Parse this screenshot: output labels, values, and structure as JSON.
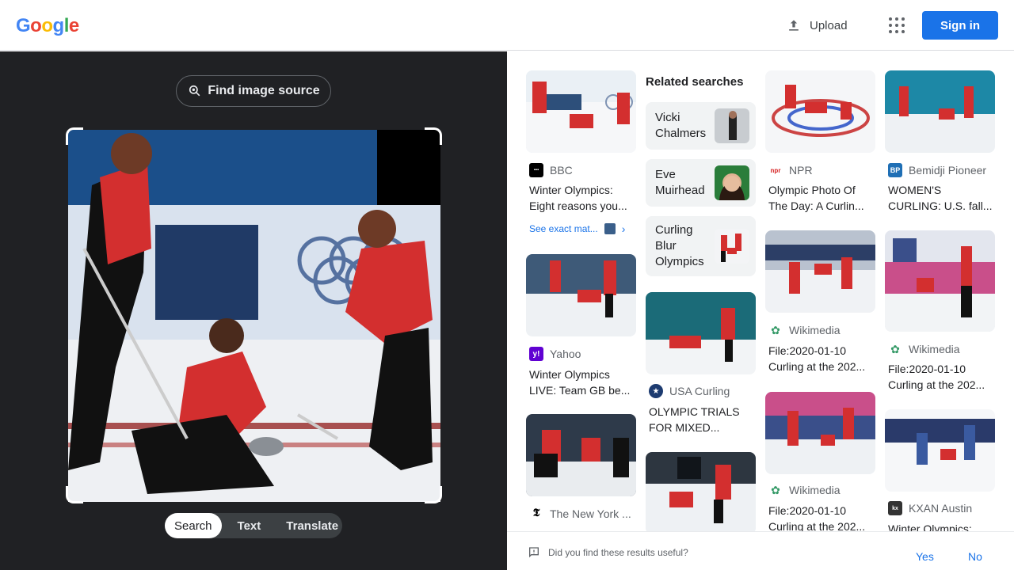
{
  "header": {
    "logo_letters": [
      "G",
      "o",
      "o",
      "g",
      "l",
      "e"
    ],
    "logo_colors": [
      "#4285f4",
      "#ea4335",
      "#fbbc05",
      "#4285f4",
      "#34a853",
      "#ea4335"
    ],
    "upload_label": "Upload",
    "apps_icon": "apps-grid-icon",
    "signin_label": "Sign in"
  },
  "left_panel": {
    "find_source_label": "Find image source",
    "modes": [
      "Search",
      "Text",
      "Translate"
    ],
    "active_mode": "Search"
  },
  "results": {
    "col1": [
      {
        "source": "BBC",
        "title1": "Winter Olympics:",
        "title2": "Eight reasons you...",
        "exact_label": "See exact mat..."
      },
      {
        "source": "Yahoo",
        "title1": "Winter Olympics",
        "title2": "LIVE: Team GB be..."
      },
      {
        "source": "The New York ..."
      }
    ],
    "related": {
      "heading": "Related searches",
      "items": [
        {
          "line1": "Vicki",
          "line2": "Chalmers"
        },
        {
          "line1": "Eve",
          "line2": "Muirhead"
        },
        {
          "line1": "Curling",
          "line2": "Blur",
          "line3": "Olympics"
        }
      ]
    },
    "col2": [
      {
        "source": "USA Curling",
        "title1": "OLYMPIC TRIALS",
        "title2": "FOR MIXED..."
      }
    ],
    "col3": [
      {
        "source": "NPR",
        "title1": "Olympic Photo Of",
        "title2": "The Day: A Curlin..."
      },
      {
        "source": "Wikimedia",
        "title1": "File:2020-01-10",
        "title2": "Curling at the 202..."
      },
      {
        "source": "Wikimedia",
        "title1": "File:2020-01-10",
        "title2": "Curling at the 202..."
      }
    ],
    "col4": [
      {
        "source": "Bemidji Pioneer",
        "title1": "WOMEN'S",
        "title2": "CURLING: U.S. fall..."
      },
      {
        "source": "Wikimedia",
        "title1": "File:2020-01-10",
        "title2": "Curling at the 202..."
      },
      {
        "source": "KXAN Austin",
        "title1": "Winter Olympics:"
      }
    ]
  },
  "feedback": {
    "question": "Did you find these results useful?",
    "yes": "Yes",
    "no": "No"
  }
}
